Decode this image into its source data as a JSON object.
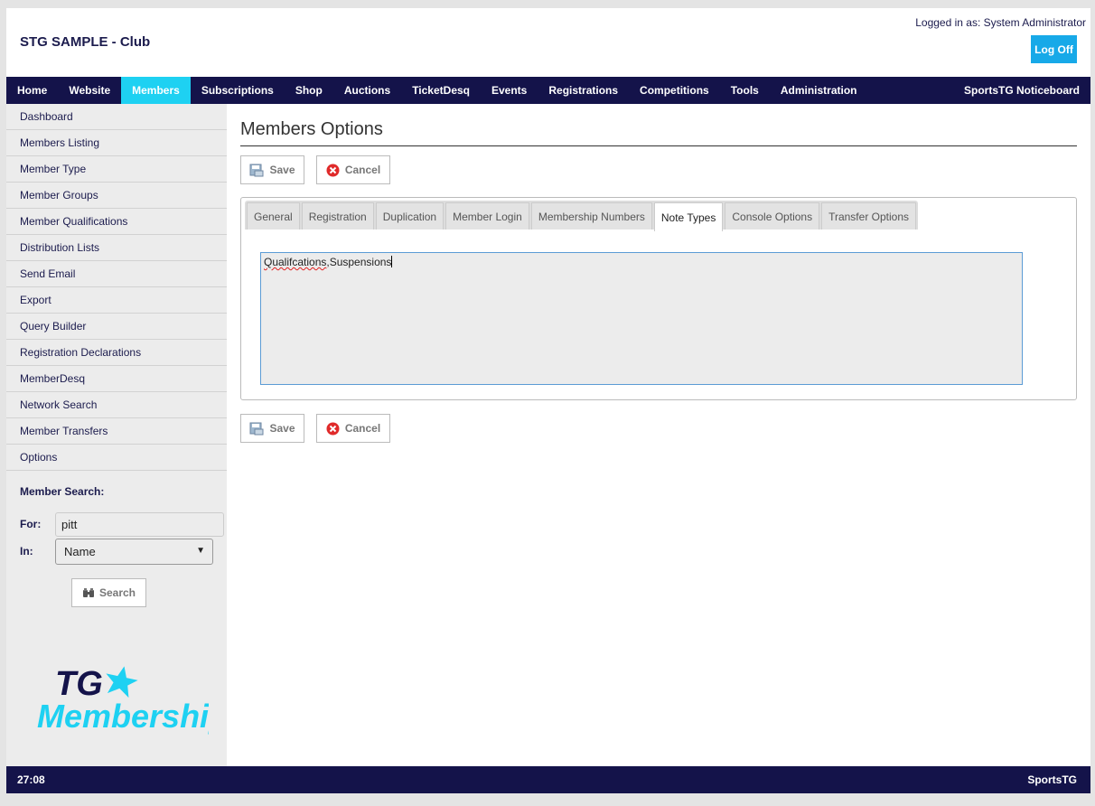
{
  "header": {
    "club_title": "STG SAMPLE - Club",
    "logged_in_text": "Logged in as: System Administrator",
    "logoff_label": "Log Off"
  },
  "topnav": {
    "items": [
      "Home",
      "Website",
      "Members",
      "Subscriptions",
      "Shop",
      "Auctions",
      "TicketDesq",
      "Events",
      "Registrations",
      "Competitions",
      "Tools",
      "Administration"
    ],
    "active": "Members",
    "right_link": "SportsTG Noticeboard",
    "active_color": "#1ed1f2",
    "bar_color": "#14134a"
  },
  "sidebar": {
    "items": [
      "Dashboard",
      "Members Listing",
      "Member Type",
      "Member Groups",
      "Member Qualifications",
      "Distribution Lists",
      "Send Email",
      "Export",
      "Query Builder",
      "Registration Declarations",
      "MemberDesq",
      "Network Search",
      "Member Transfers",
      "Options"
    ],
    "search": {
      "title": "Member Search:",
      "for_label": "For:",
      "for_value": "pitt",
      "in_label": "In:",
      "in_selected": "Name",
      "button_label": "Search",
      "button_icon": "binoculars-icon"
    },
    "logo": {
      "line1": "TG",
      "line2": "Membership"
    }
  },
  "main": {
    "title": "Members Options",
    "save_label": "Save",
    "cancel_label": "Cancel",
    "tabs": [
      "General",
      "Registration",
      "Duplication",
      "Member Login",
      "Membership Numbers",
      "Note Types",
      "Console Options",
      "Transfer Options"
    ],
    "active_tab": "Note Types",
    "note_types": {
      "misspelled_word": "Qualifcations",
      "rest": ",Suspensions"
    }
  },
  "footer": {
    "left": "27:08",
    "right": "SportsTG"
  }
}
